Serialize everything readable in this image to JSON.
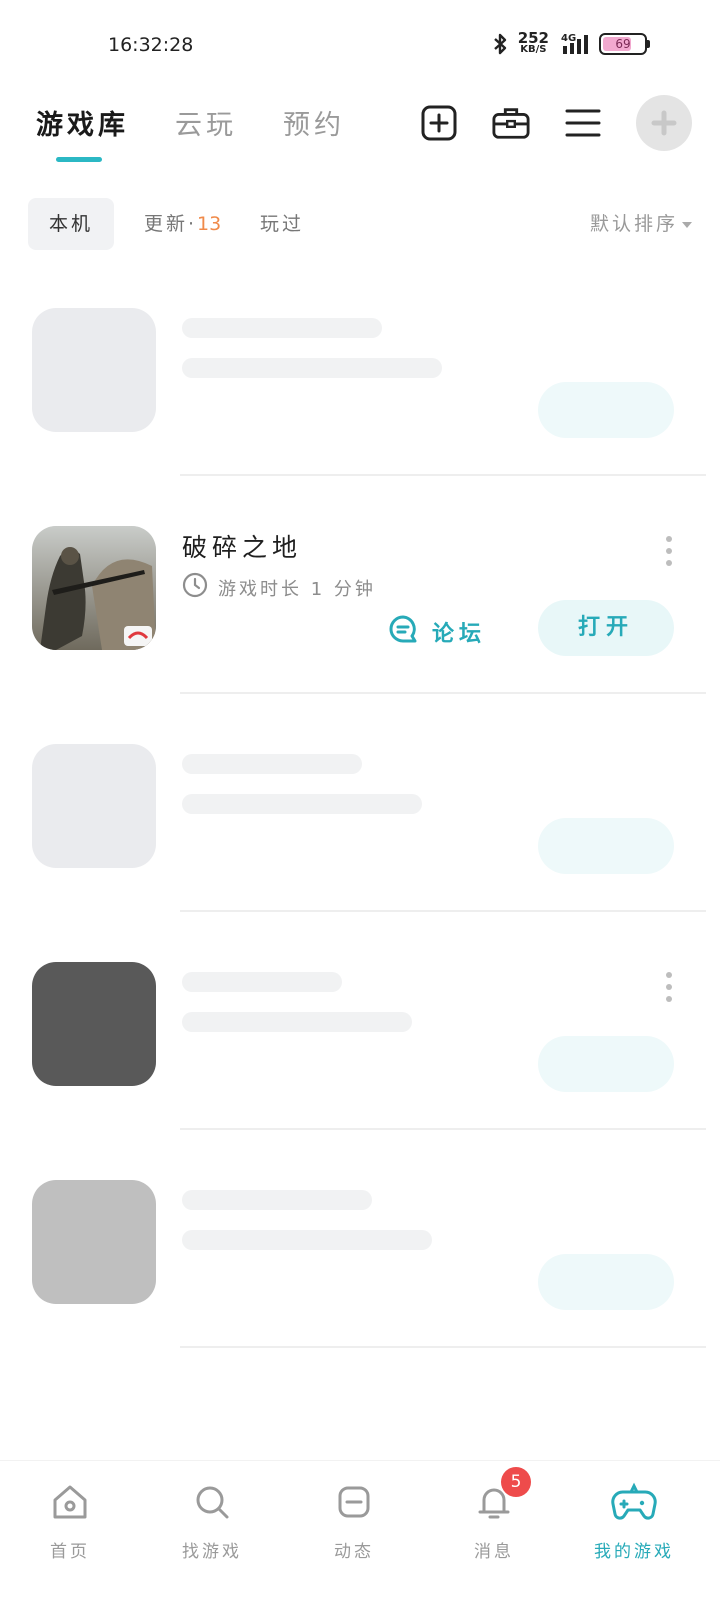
{
  "status_bar": {
    "time": "16:32:28",
    "net_speed_value": "252",
    "net_speed_unit": "KB/S",
    "network": "4G",
    "battery": "69",
    "battery_level": 0.69
  },
  "header": {
    "tabs": [
      {
        "label": "游戏库",
        "active": true
      },
      {
        "label": "云玩",
        "active": false
      },
      {
        "label": "预约",
        "active": false
      }
    ],
    "icons": [
      "add-square-icon",
      "toolbox-icon",
      "menu-icon",
      "avatar"
    ]
  },
  "filter": {
    "local": "本机",
    "update_label": "更新·",
    "update_count": "13",
    "played": "玩过",
    "sort": "默认排序"
  },
  "games": [
    {
      "name": "破碎之地",
      "playtime": "游戏时长 1 分钟",
      "forum": "论坛",
      "open": "打开"
    }
  ],
  "bottom_nav": [
    {
      "label": "首页",
      "icon": "home-icon",
      "active": false
    },
    {
      "label": "找游戏",
      "icon": "find-game-icon",
      "active": false
    },
    {
      "label": "动态",
      "icon": "feed-icon",
      "active": false
    },
    {
      "label": "消息",
      "icon": "bell-icon",
      "active": false,
      "badge": "5"
    },
    {
      "label": "我的游戏",
      "icon": "gamepad-icon",
      "active": true
    }
  ],
  "colors": {
    "accent": "#27aab8",
    "badge": "#ee4b4b",
    "update_count": "#f08a4a"
  }
}
